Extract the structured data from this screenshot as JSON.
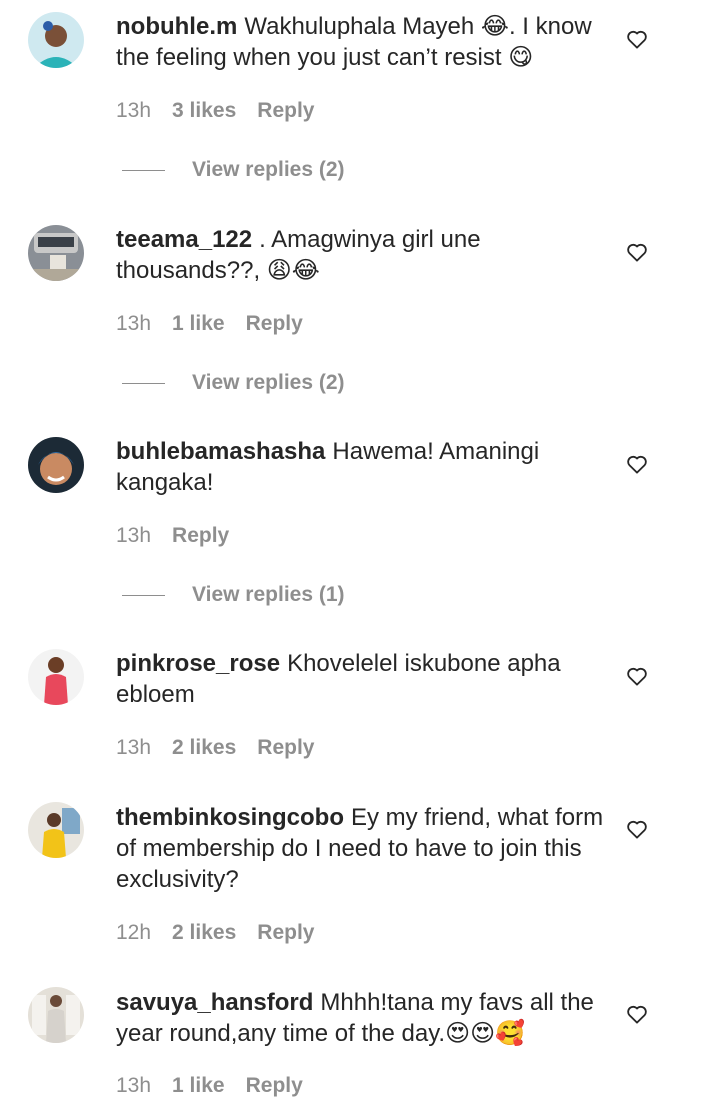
{
  "comments": [
    {
      "username": "nobuhle.m",
      "text": "Wakhuluphala Mayeh 😂. I know the feeling when you just can’t resist 😋",
      "time": "13h",
      "likes": "3 likes",
      "reply": "Reply",
      "view_replies": "View replies (2)",
      "avatar_icon": "avatar-photo",
      "avatar_bg": "#cfe9f0"
    },
    {
      "username": "teeama_122",
      "text": ". Amagwinya girl une thousands??, 😩😂",
      "time": "13h",
      "likes": "1 like",
      "reply": "Reply",
      "view_replies": "View replies (2)",
      "avatar_icon": "avatar-photo",
      "avatar_bg": "#8a8f96"
    },
    {
      "username": "buhlebamashasha",
      "text": "Hawema! Amaningi kangaka!",
      "time": "13h",
      "reply": "Reply",
      "view_replies": "View replies (1)",
      "avatar_icon": "avatar-photo",
      "avatar_bg": "#1c2a36"
    },
    {
      "username": "pinkrose_rose",
      "text": "Khovelelel iskubone apha ebloem",
      "time": "13h",
      "likes": "2 likes",
      "reply": "Reply",
      "avatar_icon": "avatar-photo",
      "avatar_bg": "#f3f3f3"
    },
    {
      "username": "thembinkosingcobo",
      "text": "Ey my friend, what form of membership do I need to have to join this exclusivity?",
      "time": "12h",
      "likes": "2 likes",
      "reply": "Reply",
      "avatar_icon": "avatar-photo",
      "avatar_bg": "#e9e6df"
    },
    {
      "username": "savuya_hansford",
      "text": "Mhhh!tana my favs all the year round,any time of the day.😍😍🥰",
      "time": "13h",
      "likes": "1 like",
      "reply": "Reply",
      "avatar_icon": "avatar-photo",
      "avatar_bg": "#e4e0d8"
    }
  ],
  "like_icon": "heart-outline-icon"
}
